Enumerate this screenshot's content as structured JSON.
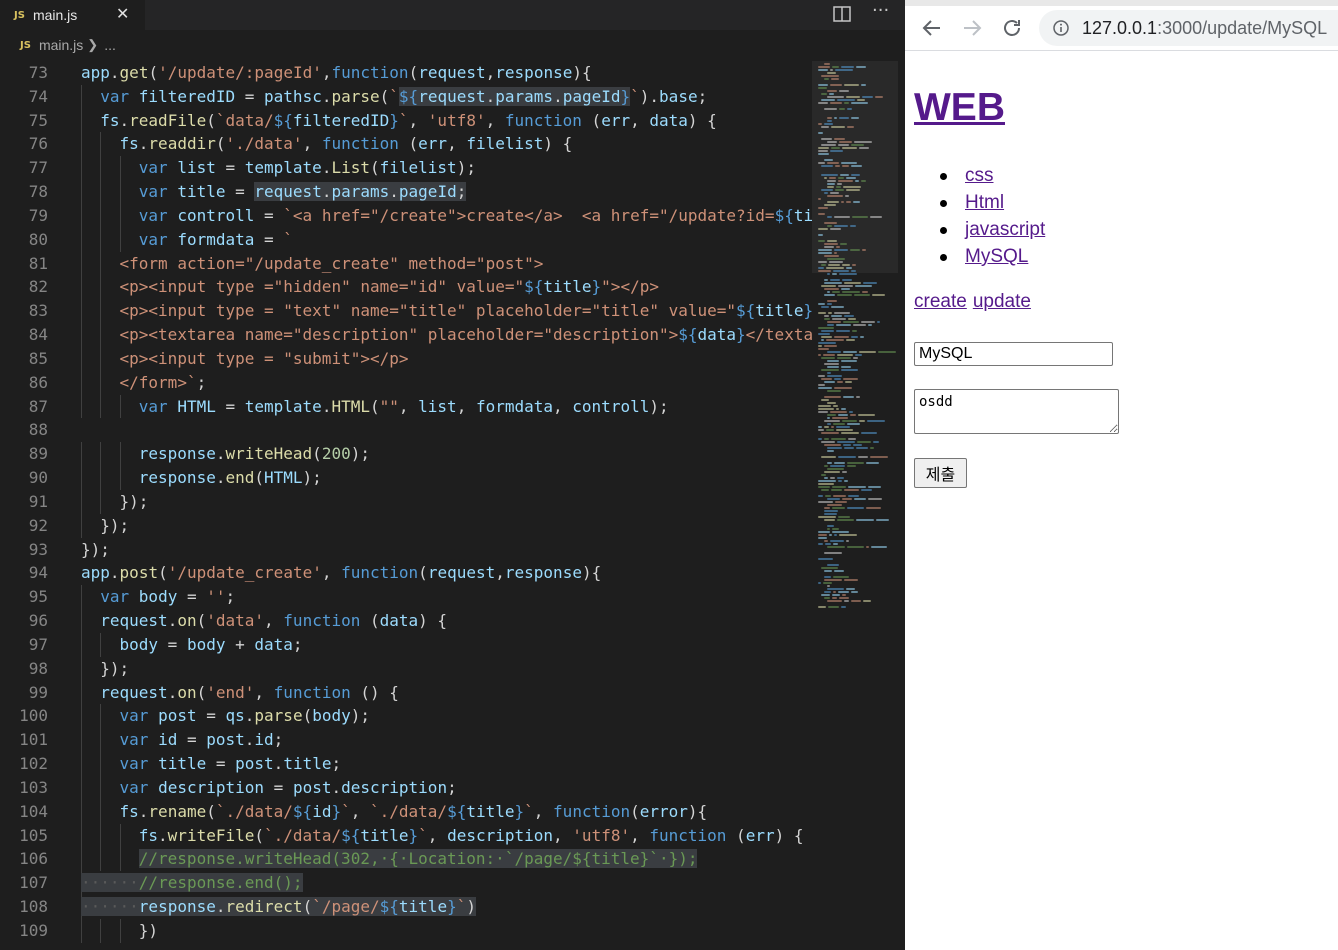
{
  "editor": {
    "tab": {
      "badge": "JS",
      "filename": "main.js"
    },
    "breadcrumb": {
      "badge": "JS",
      "file": "main.js",
      "ellipsis": "..."
    },
    "first_line": 73,
    "lines": [
      [
        [
          0,
          ""
        ],
        [
          "v",
          "app"
        ],
        [
          "p",
          "."
        ],
        [
          "f",
          "get"
        ],
        [
          "p",
          "("
        ],
        [
          "s",
          "'/update/:pageId'"
        ],
        [
          "p",
          ","
        ],
        [
          "k",
          "function"
        ],
        [
          "p",
          "("
        ],
        [
          "v",
          "request"
        ],
        [
          "p",
          ","
        ],
        [
          "v",
          "response"
        ],
        [
          "p",
          "){"
        ]
      ],
      [
        [
          1,
          ""
        ],
        [
          "k",
          "var"
        ],
        [
          "p",
          " "
        ],
        [
          "v",
          "filteredID"
        ],
        [
          "p",
          " = "
        ],
        [
          "v",
          "pathsc"
        ],
        [
          "p",
          "."
        ],
        [
          "f",
          "parse"
        ],
        [
          "p",
          "("
        ],
        [
          "s",
          "`"
        ],
        [
          "hk",
          "${"
        ],
        [
          "hv",
          "request"
        ],
        [
          "hp",
          "."
        ],
        [
          "hv",
          "params"
        ],
        [
          "hp",
          "."
        ],
        [
          "hv",
          "pageId"
        ],
        [
          "hk",
          "}"
        ],
        [
          "s",
          "`"
        ],
        [
          "p",
          ")."
        ],
        [
          "v",
          "base"
        ],
        [
          "p",
          ";"
        ]
      ],
      [
        [
          1,
          ""
        ],
        [
          "v",
          "fs"
        ],
        [
          "p",
          "."
        ],
        [
          "f",
          "readFile"
        ],
        [
          "p",
          "("
        ],
        [
          "s",
          "`data/"
        ],
        [
          "k",
          "${"
        ],
        [
          "v",
          "filteredID"
        ],
        [
          "k",
          "}"
        ],
        [
          "s",
          "`"
        ],
        [
          "p",
          ", "
        ],
        [
          "s",
          "'utf8'"
        ],
        [
          "p",
          ", "
        ],
        [
          "k",
          "function"
        ],
        [
          "p",
          " ("
        ],
        [
          "v",
          "err"
        ],
        [
          "p",
          ", "
        ],
        [
          "v",
          "data"
        ],
        [
          "p",
          ") {"
        ]
      ],
      [
        [
          2,
          ""
        ],
        [
          "v",
          "fs"
        ],
        [
          "p",
          "."
        ],
        [
          "f",
          "readdir"
        ],
        [
          "p",
          "("
        ],
        [
          "s",
          "'./data'"
        ],
        [
          "p",
          ", "
        ],
        [
          "k",
          "function"
        ],
        [
          "p",
          " ("
        ],
        [
          "v",
          "err"
        ],
        [
          "p",
          ", "
        ],
        [
          "v",
          "filelist"
        ],
        [
          "p",
          ") {"
        ]
      ],
      [
        [
          3,
          ""
        ],
        [
          "k",
          "var"
        ],
        [
          "p",
          " "
        ],
        [
          "v",
          "list"
        ],
        [
          "p",
          " = "
        ],
        [
          "v",
          "template"
        ],
        [
          "p",
          "."
        ],
        [
          "f",
          "List"
        ],
        [
          "p",
          "("
        ],
        [
          "v",
          "filelist"
        ],
        [
          "p",
          ");"
        ]
      ],
      [
        [
          3,
          ""
        ],
        [
          "k",
          "var"
        ],
        [
          "p",
          " "
        ],
        [
          "v",
          "title"
        ],
        [
          "p",
          " = "
        ],
        [
          "hv",
          "request"
        ],
        [
          "hp",
          "."
        ],
        [
          "hv",
          "params"
        ],
        [
          "hp",
          "."
        ],
        [
          "hv",
          "pageId"
        ],
        [
          "hp",
          ";"
        ]
      ],
      [
        [
          3,
          ""
        ],
        [
          "k",
          "var"
        ],
        [
          "p",
          " "
        ],
        [
          "v",
          "controll"
        ],
        [
          "p",
          " = "
        ],
        [
          "s",
          "`<a href=\"/create\">create</a>  <a href=\"/update?id="
        ],
        [
          "k",
          "${"
        ],
        [
          "v",
          "ti"
        ]
      ],
      [
        [
          3,
          ""
        ],
        [
          "k",
          "var"
        ],
        [
          "p",
          " "
        ],
        [
          "v",
          "formdata"
        ],
        [
          "p",
          " = "
        ],
        [
          "s",
          "`"
        ]
      ],
      [
        [
          2,
          ""
        ],
        [
          "s",
          "<form action=\"/update_create\" method=\"post\">"
        ]
      ],
      [
        [
          2,
          ""
        ],
        [
          "s",
          "<p><input type =\"hidden\" name=\"id\" value=\""
        ],
        [
          "k",
          "${"
        ],
        [
          "v",
          "title"
        ],
        [
          "k",
          "}"
        ],
        [
          "s",
          "\"></p>"
        ]
      ],
      [
        [
          2,
          ""
        ],
        [
          "s",
          "<p><input type = \"text\" name=\"title\" placeholder=\"title\" value=\""
        ],
        [
          "k",
          "${"
        ],
        [
          "v",
          "title"
        ],
        [
          "k",
          "}"
        ]
      ],
      [
        [
          2,
          ""
        ],
        [
          "s",
          "<p><textarea name=\"description\" placeholder=\"description\">"
        ],
        [
          "k",
          "${"
        ],
        [
          "v",
          "data"
        ],
        [
          "k",
          "}"
        ],
        [
          "s",
          "</texta"
        ]
      ],
      [
        [
          2,
          ""
        ],
        [
          "s",
          "<p><input type = \"submit\"></p>"
        ]
      ],
      [
        [
          2,
          ""
        ],
        [
          "s",
          "</form>`"
        ],
        [
          "p",
          ";"
        ]
      ],
      [
        [
          3,
          ""
        ],
        [
          "k",
          "var"
        ],
        [
          "p",
          " "
        ],
        [
          "v",
          "HTML"
        ],
        [
          "p",
          " = "
        ],
        [
          "v",
          "template"
        ],
        [
          "p",
          "."
        ],
        [
          "f",
          "HTML"
        ],
        [
          "p",
          "("
        ],
        [
          "s",
          "\"\""
        ],
        [
          "p",
          ", "
        ],
        [
          "v",
          "list"
        ],
        [
          "p",
          ", "
        ],
        [
          "v",
          "formdata"
        ],
        [
          "p",
          ", "
        ],
        [
          "v",
          "controll"
        ],
        [
          "p",
          ");"
        ]
      ],
      [
        [
          0,
          ""
        ]
      ],
      [
        [
          3,
          ""
        ],
        [
          "v",
          "response"
        ],
        [
          "p",
          "."
        ],
        [
          "f",
          "writeHead"
        ],
        [
          "p",
          "("
        ],
        [
          "n",
          "200"
        ],
        [
          "p",
          ");"
        ]
      ],
      [
        [
          3,
          ""
        ],
        [
          "v",
          "response"
        ],
        [
          "p",
          "."
        ],
        [
          "f",
          "end"
        ],
        [
          "p",
          "("
        ],
        [
          "v",
          "HTML"
        ],
        [
          "p",
          ");"
        ]
      ],
      [
        [
          2,
          ""
        ],
        [
          "p",
          "});"
        ]
      ],
      [
        [
          1,
          ""
        ],
        [
          "p",
          "});"
        ]
      ],
      [
        [
          0,
          ""
        ],
        [
          "p",
          "});"
        ]
      ],
      [
        [
          0,
          ""
        ],
        [
          "v",
          "app"
        ],
        [
          "p",
          "."
        ],
        [
          "f",
          "post"
        ],
        [
          "p",
          "("
        ],
        [
          "s",
          "'/update_create'"
        ],
        [
          "p",
          ", "
        ],
        [
          "k",
          "function"
        ],
        [
          "p",
          "("
        ],
        [
          "v",
          "request"
        ],
        [
          "p",
          ","
        ],
        [
          "v",
          "response"
        ],
        [
          "p",
          "){"
        ]
      ],
      [
        [
          1,
          ""
        ],
        [
          "k",
          "var"
        ],
        [
          "p",
          " "
        ],
        [
          "v",
          "body"
        ],
        [
          "p",
          " = "
        ],
        [
          "s",
          "''"
        ],
        [
          "p",
          ";"
        ]
      ],
      [
        [
          1,
          ""
        ],
        [
          "v",
          "request"
        ],
        [
          "p",
          "."
        ],
        [
          "f",
          "on"
        ],
        [
          "p",
          "("
        ],
        [
          "s",
          "'data'"
        ],
        [
          "p",
          ", "
        ],
        [
          "k",
          "function"
        ],
        [
          "p",
          " ("
        ],
        [
          "v",
          "data"
        ],
        [
          "p",
          ") {"
        ]
      ],
      [
        [
          2,
          ""
        ],
        [
          "v",
          "body"
        ],
        [
          "p",
          " = "
        ],
        [
          "v",
          "body"
        ],
        [
          "p",
          " + "
        ],
        [
          "v",
          "data"
        ],
        [
          "p",
          ";"
        ]
      ],
      [
        [
          1,
          ""
        ],
        [
          "p",
          "});"
        ]
      ],
      [
        [
          1,
          ""
        ],
        [
          "v",
          "request"
        ],
        [
          "p",
          "."
        ],
        [
          "f",
          "on"
        ],
        [
          "p",
          "("
        ],
        [
          "s",
          "'end'"
        ],
        [
          "p",
          ", "
        ],
        [
          "k",
          "function"
        ],
        [
          "p",
          " () {"
        ]
      ],
      [
        [
          2,
          ""
        ],
        [
          "k",
          "var"
        ],
        [
          "p",
          " "
        ],
        [
          "v",
          "post"
        ],
        [
          "p",
          " = "
        ],
        [
          "v",
          "qs"
        ],
        [
          "p",
          "."
        ],
        [
          "f",
          "parse"
        ],
        [
          "p",
          "("
        ],
        [
          "v",
          "body"
        ],
        [
          "p",
          ");"
        ]
      ],
      [
        [
          2,
          ""
        ],
        [
          "k",
          "var"
        ],
        [
          "p",
          " "
        ],
        [
          "v",
          "id"
        ],
        [
          "p",
          " = "
        ],
        [
          "v",
          "post"
        ],
        [
          "p",
          "."
        ],
        [
          "v",
          "id"
        ],
        [
          "p",
          ";"
        ]
      ],
      [
        [
          2,
          ""
        ],
        [
          "k",
          "var"
        ],
        [
          "p",
          " "
        ],
        [
          "v",
          "title"
        ],
        [
          "p",
          " = "
        ],
        [
          "v",
          "post"
        ],
        [
          "p",
          "."
        ],
        [
          "v",
          "title"
        ],
        [
          "p",
          ";"
        ]
      ],
      [
        [
          2,
          ""
        ],
        [
          "k",
          "var"
        ],
        [
          "p",
          " "
        ],
        [
          "v",
          "description"
        ],
        [
          "p",
          " = "
        ],
        [
          "v",
          "post"
        ],
        [
          "p",
          "."
        ],
        [
          "v",
          "description"
        ],
        [
          "p",
          ";"
        ]
      ],
      [
        [
          2,
          ""
        ],
        [
          "v",
          "fs"
        ],
        [
          "p",
          "."
        ],
        [
          "f",
          "rename"
        ],
        [
          "p",
          "("
        ],
        [
          "s",
          "`./data/"
        ],
        [
          "k",
          "${"
        ],
        [
          "v",
          "id"
        ],
        [
          "k",
          "}"
        ],
        [
          "s",
          "`"
        ],
        [
          "p",
          ", "
        ],
        [
          "s",
          "`./data/"
        ],
        [
          "k",
          "${"
        ],
        [
          "v",
          "title"
        ],
        [
          "k",
          "}"
        ],
        [
          "s",
          "`"
        ],
        [
          "p",
          ", "
        ],
        [
          "k",
          "function"
        ],
        [
          "p",
          "("
        ],
        [
          "v",
          "error"
        ],
        [
          "p",
          "){"
        ]
      ],
      [
        [
          3,
          ""
        ],
        [
          "v",
          "fs"
        ],
        [
          "p",
          "."
        ],
        [
          "f",
          "writeFile"
        ],
        [
          "p",
          "("
        ],
        [
          "s",
          "`./data/"
        ],
        [
          "k",
          "${"
        ],
        [
          "v",
          "title"
        ],
        [
          "k",
          "}"
        ],
        [
          "s",
          "`"
        ],
        [
          "p",
          ", "
        ],
        [
          "v",
          "description"
        ],
        [
          "p",
          ", "
        ],
        [
          "s",
          "'utf8'"
        ],
        [
          "p",
          ", "
        ],
        [
          "k",
          "function"
        ],
        [
          "p",
          " ("
        ],
        [
          "v",
          "err"
        ],
        [
          "p",
          ") {"
        ]
      ],
      [
        [
          3,
          ""
        ],
        [
          "hc",
          "//response.writeHead(302,·{·Location:·`/page/${title}`·});"
        ]
      ],
      [
        [
          0,
          ""
        ],
        [
          "hw",
          "······"
        ],
        [
          "hc",
          "//response.end();"
        ]
      ],
      [
        [
          0,
          ""
        ],
        [
          "hw",
          "······"
        ],
        [
          "hv",
          "response"
        ],
        [
          "hp",
          "."
        ],
        [
          "hf",
          "redirect"
        ],
        [
          "hp",
          "("
        ],
        [
          "hs",
          "`/page/"
        ],
        [
          "hk",
          "${"
        ],
        [
          "hv",
          "title"
        ],
        [
          "hk",
          "}"
        ],
        [
          "hs",
          "`"
        ],
        [
          "hp",
          ")"
        ]
      ],
      [
        [
          3,
          ""
        ],
        [
          "p",
          "})"
        ]
      ]
    ]
  },
  "browser": {
    "url_host": "127.0.0.1",
    "url_path": ":3000/update/MySQL",
    "site_title": "WEB",
    "topics": [
      "css",
      "Html",
      "javascript",
      "MySQL"
    ],
    "controls": {
      "create": "create",
      "update": "update"
    },
    "form": {
      "title_value": "MySQL",
      "description_value": "osdd",
      "submit_label": "제출"
    }
  },
  "colors": {
    "editor_bg": "#1e1e1e",
    "keyword": "#569cd6",
    "string": "#ce9178",
    "function": "#dcdcaa",
    "variable": "#9cdcfe",
    "number": "#b5cea8",
    "comment": "#6a9955",
    "link": "#551a8b"
  }
}
